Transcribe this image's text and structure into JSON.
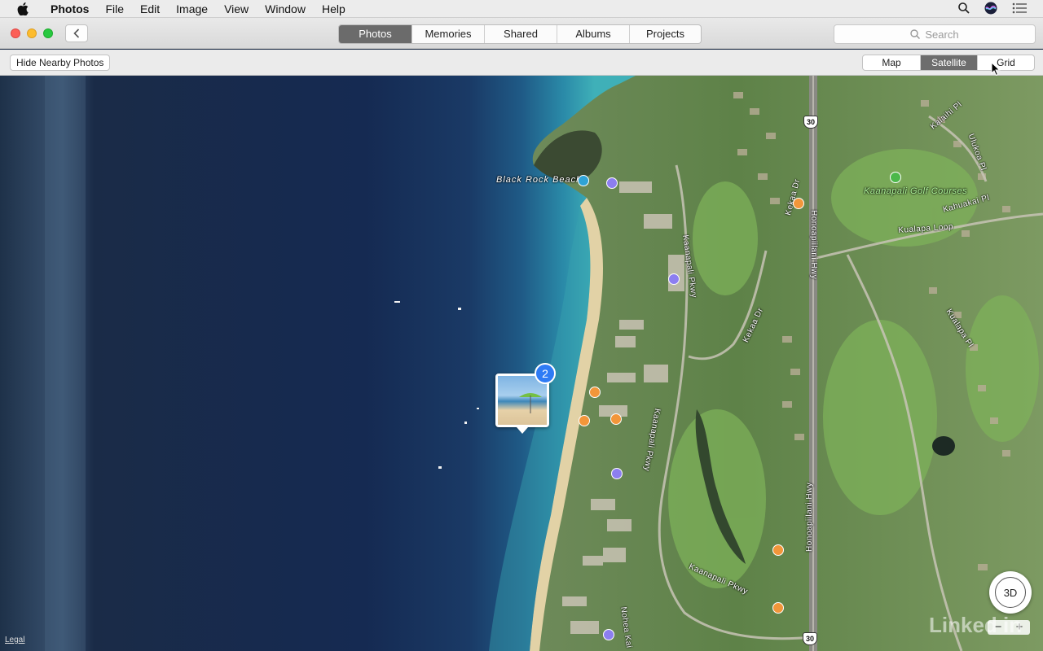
{
  "menubar": {
    "app_name": "Photos",
    "items": [
      "File",
      "Edit",
      "Image",
      "View",
      "Window",
      "Help"
    ]
  },
  "toolbar": {
    "tabs": [
      {
        "label": "Photos",
        "active": true
      },
      {
        "label": "Memories",
        "active": false
      },
      {
        "label": "Shared",
        "active": false
      },
      {
        "label": "Albums",
        "active": false
      },
      {
        "label": "Projects",
        "active": false
      }
    ],
    "search_placeholder": "Search"
  },
  "subbar": {
    "hide_button": "Hide Nearby Photos",
    "map_types": [
      {
        "label": "Map",
        "active": false
      },
      {
        "label": "Satellite",
        "active": true
      },
      {
        "label": "Grid",
        "active": false
      }
    ]
  },
  "map": {
    "labels": {
      "beach": "Black Rock Beach",
      "golf": "Kaanapali Golf Courses",
      "kaanapali_pkwy": "Kaanapali Pkwy",
      "honoapiilani_hwy": "Honoapiilani Hwy",
      "kekaa_dr": "Kekaa Dr",
      "kualapa_loop": "Kualapa Loop",
      "kahuakai_pl": "Kahuakai Pl",
      "kalaihi_pl": "Kalaihi Pl",
      "ulukoa_pl": "Ulukoa Pl",
      "kualapa_pl": "Kualapa Pl",
      "nohea_kai": "Nohea Kai"
    },
    "route_shield": "30",
    "photo_count": "2",
    "compass_label": "3D",
    "zoom_out": "−",
    "zoom_in": "+",
    "legal": "Legal",
    "watermark": "Linked in"
  }
}
